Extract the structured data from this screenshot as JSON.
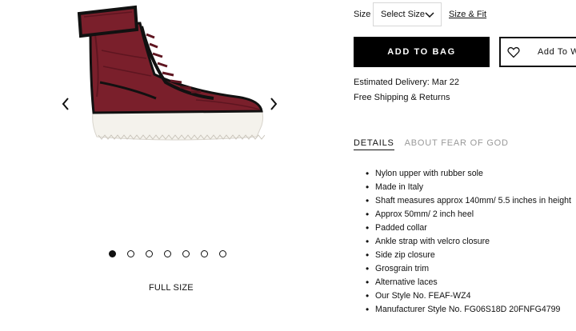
{
  "gallery": {
    "full_size_label": "FULL SIZE",
    "dot_count": 7,
    "active_index": 0
  },
  "purchase": {
    "size_label": "Size",
    "size_select_value": "Select Size",
    "size_fit_link": "Size & Fit",
    "add_to_bag": "ADD TO BAG",
    "wishlist": "Add To W",
    "delivery": "Estimated Delivery: Mar 22",
    "shipping": "Free Shipping & Returns"
  },
  "tabs": [
    {
      "label": "DETAILS",
      "active": true
    },
    {
      "label": "ABOUT FEAR OF GOD",
      "active": false
    }
  ],
  "details": [
    "Nylon upper with rubber sole",
    "Made in Italy",
    "Shaft measures approx 140mm/ 5.5 inches in height",
    "Approx 50mm/ 2 inch heel",
    "Padded collar",
    "Ankle strap with velcro closure",
    "Side zip closure",
    "Grosgrain trim",
    "Alternative laces",
    "Our Style No. FEAF-WZ4",
    "Manufacturer Style No. FG06S18D 20FNFG4799"
  ],
  "colors": {
    "shoe_body": "#7a1f2b",
    "shoe_trim": "#111111",
    "sole": "#f4f2ec",
    "button_bg": "#000000"
  },
  "icons": {
    "prev": "chevron-left-icon",
    "next": "chevron-right-icon",
    "dropdown": "chevron-down-icon",
    "wishlist": "heart-icon"
  }
}
